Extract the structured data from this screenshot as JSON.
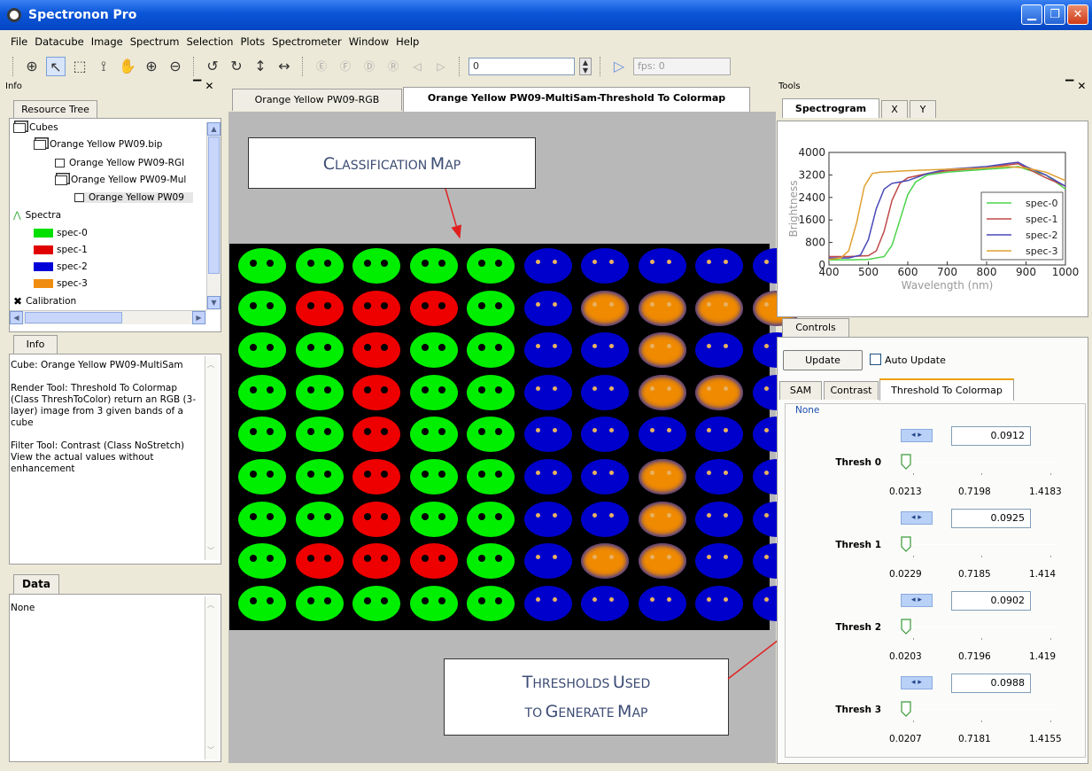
{
  "window": {
    "title": "Spectronon Pro"
  },
  "menu": [
    "File",
    "Datacube",
    "Image",
    "Spectrum",
    "Selection",
    "Plots",
    "Spectrometer",
    "Window",
    "Help"
  ],
  "toolbar": {
    "frame_value": "0",
    "fps_placeholder": "fps: 0"
  },
  "left": {
    "info_panel_title": "Info",
    "resource_tab": "Resource Tree",
    "tree": {
      "cubes": "Cubes",
      "cube_file": "Orange Yellow PW09.bip",
      "child1": "Orange Yellow PW09-RGI",
      "child2": "Orange Yellow PW09-Mul",
      "child3": "Orange Yellow PW09",
      "spectra": "Spectra",
      "spec": [
        {
          "name": "spec-0",
          "color": "#00e000"
        },
        {
          "name": "spec-1",
          "color": "#e00000"
        },
        {
          "name": "spec-2",
          "color": "#0000d8"
        },
        {
          "name": "spec-3",
          "color": "#f08c10"
        }
      ],
      "calibration": "Calibration"
    },
    "info_tab": "Info",
    "info_lines": [
      "Cube: Orange Yellow PW09-MultiSam",
      "Render Tool:  Threshold To Colormap (Class ThreshToColor)  return an RGB (3-layer) image from 3 given bands of a cube",
      "Filter Tool: Contrast (Class NoStretch)   View the actual values without enhancement"
    ],
    "data_tab": "Data",
    "data_text": "None"
  },
  "doc_tabs": [
    "Orange Yellow PW09-RGB",
    "Orange Yellow PW09-MultiSam-Threshold To Colormap"
  ],
  "callouts": {
    "classification": {
      "c1": "C",
      "w1": "LASSIFICATION",
      "c2": "M",
      "w2": "AP"
    },
    "thresholds": {
      "l1c1": "T",
      "l1w1": "HRESHOLDS",
      "l1c2": "U",
      "l1w2": "SED",
      "l2a": "TO",
      "l2c1": "G",
      "l2w1": "ENERATE",
      "l2c2": "M",
      "l2w2": "AP"
    }
  },
  "colors": {
    "green": "#00ee00",
    "red": "#ee0000",
    "blue": "#0000cc",
    "orange": "#f08a00"
  },
  "chip_grid": {
    "rows": [
      [
        "g",
        "g",
        "g",
        "g",
        "g",
        "b",
        "b",
        "b",
        "b",
        "b"
      ],
      [
        "g",
        "r",
        "r",
        "r",
        "g",
        "b",
        "o",
        "o",
        "o",
        "o"
      ],
      [
        "g",
        "g",
        "r",
        "g",
        "g",
        "b",
        "b",
        "o",
        "b",
        "b"
      ],
      [
        "g",
        "g",
        "r",
        "g",
        "g",
        "b",
        "b",
        "o",
        "o",
        "b"
      ],
      [
        "g",
        "g",
        "r",
        "g",
        "g",
        "b",
        "b",
        "b",
        "b",
        "b"
      ],
      [
        "g",
        "g",
        "r",
        "g",
        "g",
        "b",
        "b",
        "o",
        "b",
        "b"
      ],
      [
        "g",
        "g",
        "r",
        "g",
        "g",
        "b",
        "b",
        "o",
        "b",
        "b"
      ],
      [
        "g",
        "r",
        "r",
        "r",
        "g",
        "b",
        "o",
        "o",
        "b",
        "b"
      ],
      [
        "g",
        "g",
        "g",
        "g",
        "g",
        "b",
        "b",
        "b",
        "b",
        "b"
      ]
    ]
  },
  "tools": {
    "panel_title": "Tools",
    "tabs": [
      "Spectrogram",
      "X",
      "Y"
    ],
    "controls_tab": "Controls",
    "update_btn": "Update",
    "auto_update": "Auto Update",
    "sub_tabs": [
      "SAM",
      "Contrast",
      "Threshold To Colormap"
    ],
    "group_label": "None",
    "thresholds": [
      {
        "label": "Thresh 0",
        "value": "0.0912",
        "min": "0.0213",
        "mid": "0.7198",
        "max": "1.4183"
      },
      {
        "label": "Thresh 1",
        "value": "0.0925",
        "min": "0.0229",
        "mid": "0.7185",
        "max": "1.414"
      },
      {
        "label": "Thresh 2",
        "value": "0.0902",
        "min": "0.0203",
        "mid": "0.7196",
        "max": "1.419"
      },
      {
        "label": "Thresh 3",
        "value": "0.0988",
        "min": "0.0207",
        "mid": "0.7181",
        "max": "1.4155"
      }
    ]
  },
  "chart_data": {
    "type": "line",
    "xlabel": "Wavelength (nm)",
    "ylabel": "Brightness",
    "xlim": [
      400,
      1000
    ],
    "ylim": [
      0,
      4000
    ],
    "xticks": [
      400,
      500,
      600,
      700,
      800,
      900,
      1000
    ],
    "yticks": [
      0,
      800,
      1600,
      2400,
      3200,
      4000
    ],
    "legend_position": "lower-right",
    "series": [
      {
        "name": "spec-0",
        "color": "#4cd44c",
        "x": [
          400,
          450,
          500,
          540,
          560,
          580,
          600,
          620,
          650,
          700,
          750,
          800,
          850,
          880,
          900,
          950,
          1000
        ],
        "y": [
          180,
          180,
          200,
          300,
          700,
          1600,
          2500,
          2950,
          3200,
          3300,
          3350,
          3400,
          3450,
          3500,
          3400,
          3200,
          2700
        ]
      },
      {
        "name": "spec-1",
        "color": "#c04848",
        "x": [
          400,
          450,
          500,
          520,
          540,
          560,
          580,
          600,
          650,
          700,
          750,
          800,
          850,
          880,
          900,
          950,
          1000
        ],
        "y": [
          300,
          300,
          330,
          500,
          1200,
          2300,
          2900,
          3100,
          3250,
          3350,
          3400,
          3450,
          3550,
          3600,
          3450,
          3100,
          2800
        ]
      },
      {
        "name": "spec-2",
        "color": "#4848b8",
        "x": [
          400,
          450,
          480,
          500,
          520,
          540,
          560,
          600,
          650,
          700,
          750,
          800,
          850,
          880,
          900,
          950,
          1000
        ],
        "y": [
          250,
          250,
          350,
          900,
          2000,
          2700,
          2900,
          3000,
          3250,
          3400,
          3450,
          3500,
          3600,
          3650,
          3500,
          3200,
          2800
        ]
      },
      {
        "name": "spec-3",
        "color": "#e0a030",
        "x": [
          400,
          430,
          450,
          470,
          490,
          510,
          530,
          560,
          600,
          650,
          700,
          750,
          800,
          850,
          900,
          950,
          1000
        ],
        "y": [
          200,
          250,
          500,
          1500,
          2800,
          3250,
          3300,
          3320,
          3350,
          3380,
          3400,
          3420,
          3450,
          3500,
          3450,
          3300,
          3000
        ]
      }
    ]
  }
}
